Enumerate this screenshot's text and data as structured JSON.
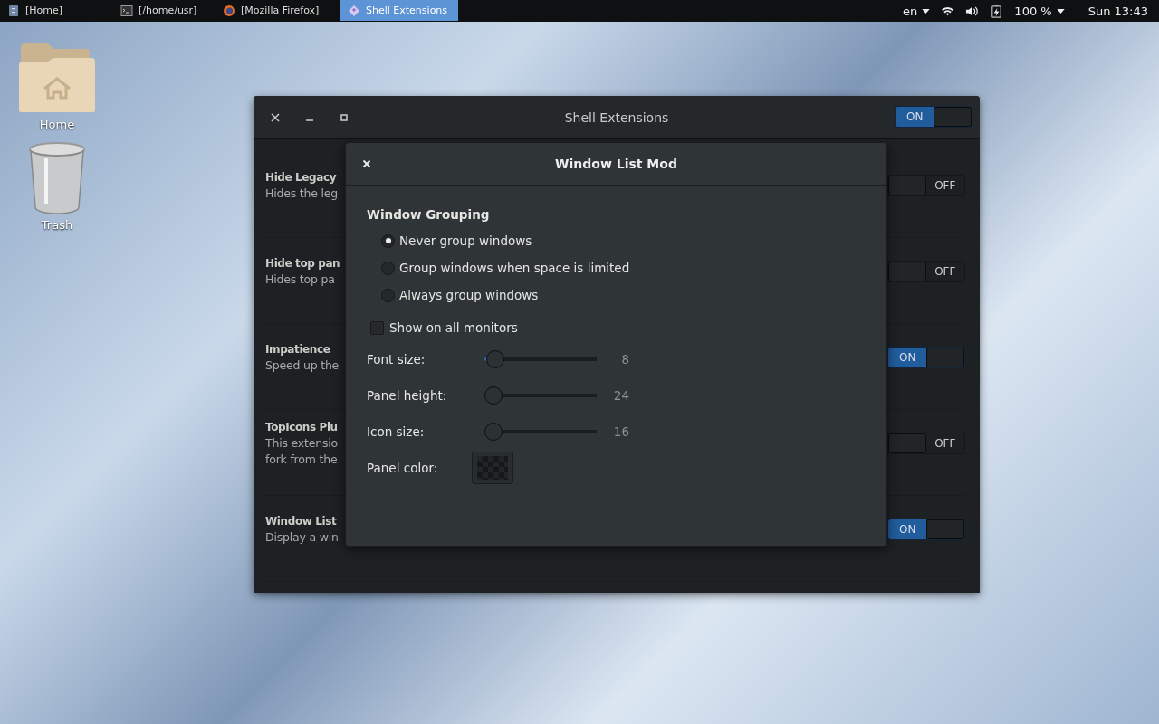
{
  "top_bar": {
    "tasks": [
      {
        "label": "[Home]",
        "kind": "files",
        "selected": false
      },
      {
        "label": "[/home/usr]",
        "kind": "terminal",
        "selected": false
      },
      {
        "label": "[Mozilla Firefox]",
        "kind": "browser",
        "selected": false
      },
      {
        "label": "Shell Extensions",
        "kind": "extensions",
        "selected": true
      }
    ],
    "keyboard": "en",
    "battery": "100 %",
    "clock": "Sun 13:43"
  },
  "desktop_icons": [
    {
      "label": "Home",
      "kind": "folder"
    },
    {
      "label": "Trash",
      "kind": "trash"
    }
  ],
  "main_window": {
    "title": "Shell Extensions",
    "on": true,
    "switch_label": "ON",
    "extensions": [
      {
        "name": "Hide Legacy",
        "description": [
          "Hides the leg"
        ],
        "on": false,
        "switch_label": "OFF"
      },
      {
        "name": "Hide top pan",
        "description": [
          "Hides top pa"
        ],
        "on": false,
        "switch_label": "OFF"
      },
      {
        "name": "Impatience",
        "description": [
          "Speed up the"
        ],
        "on": true,
        "switch_label": "ON"
      },
      {
        "name": "TopIcons Plu",
        "description": [
          "This extensio",
          "fork from the"
        ],
        "on": false,
        "switch_label": "OFF"
      },
      {
        "name": "Window List",
        "description": [
          "Display a win"
        ],
        "on": true,
        "switch_label": "ON"
      }
    ]
  },
  "dialog": {
    "title": "Window List Mod",
    "section_title": "Window Grouping",
    "radios": [
      {
        "label": "Never group windows",
        "selected": true
      },
      {
        "label": "Group windows when space is limited",
        "selected": false
      },
      {
        "label": "Always group windows",
        "selected": false
      }
    ],
    "checkboxes": [
      {
        "label": "Show on all monitors",
        "checked": false
      }
    ],
    "sliders": [
      {
        "label": "Font size:",
        "level": 0.02,
        "reading": "8"
      },
      {
        "label": "Panel height:",
        "level": 0,
        "reading": "24"
      },
      {
        "label": "Icon size:",
        "level": 0,
        "reading": "16"
      }
    ],
    "color": {
      "label": "Panel color:"
    }
  }
}
